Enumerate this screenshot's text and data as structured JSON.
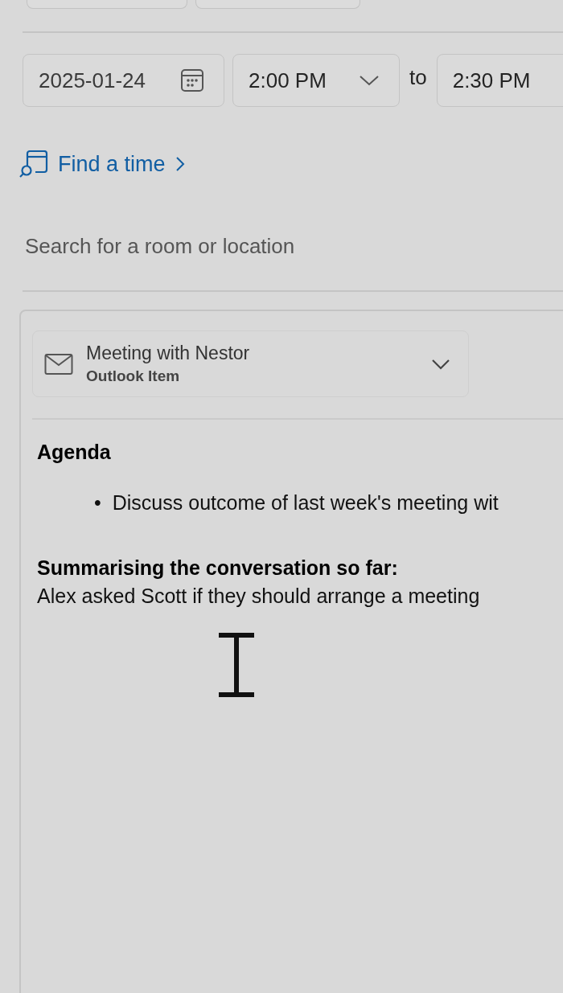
{
  "top_fields": [
    {
      "kind": "field"
    },
    {
      "kind": "field"
    }
  ],
  "schedule": {
    "date": "2025-01-24",
    "start_time": "2:00 PM",
    "separator": "to",
    "end_time": "2:30 PM"
  },
  "find_time": {
    "label": "Find a time"
  },
  "location": {
    "placeholder": "Search for a room or location"
  },
  "attachment": {
    "title": "Meeting with Nestor",
    "subtitle": "Outlook Item",
    "expanded": false
  },
  "body": {
    "heading": "Agenda",
    "bullets": [
      {
        "marker": "•",
        "text": "Discuss outcome of last week's meeting wit"
      }
    ],
    "summary_heading": "Summarising the conversation so far:",
    "summary_text": "Alex asked Scott if they should arrange a meeting"
  }
}
